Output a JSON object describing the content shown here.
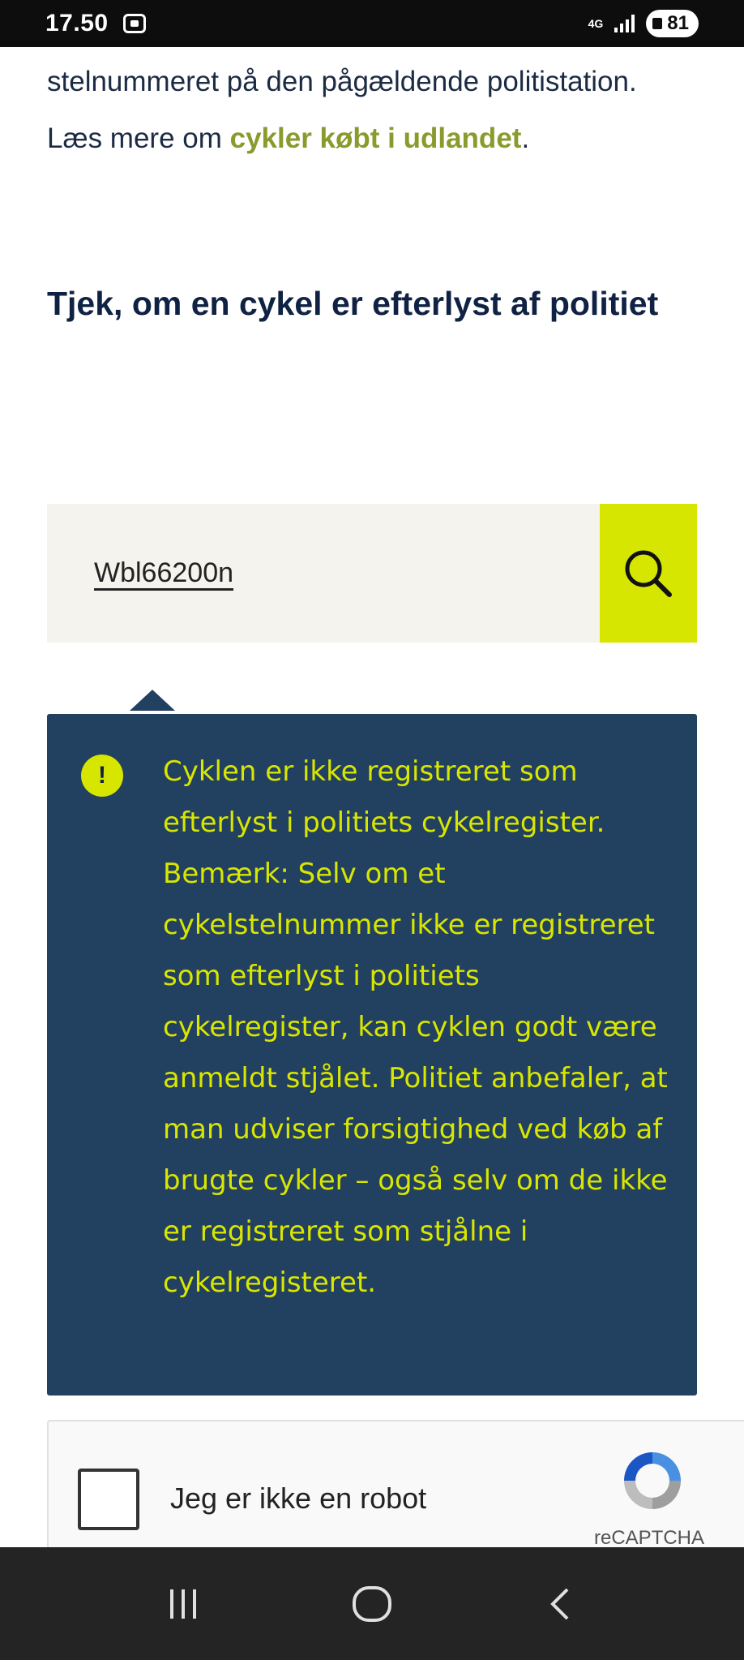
{
  "status_bar": {
    "time": "17.50",
    "network": "4G",
    "battery": "81"
  },
  "intro": {
    "text_before": "stelnummeret på den pågældende politistation. Læs mere om ",
    "link": "cykler købt i udlandet",
    "text_after": "."
  },
  "heading": "Tjek, om en cykel er efterlyst af politiet",
  "search": {
    "value": "Wbl66200n",
    "button_icon": "search-icon"
  },
  "notice": {
    "icon": "exclamation-icon",
    "icon_glyph": "!",
    "message": "Cyklen er ikke registreret som efterlyst i politiets cykelregister. Bemærk: Selv om et cykelstelnummer ikke er registreret som efterlyst i politiets cykelregister, kan cyklen godt være anmeldt stjålet. Politiet anbefaler, at man udviser forsigtighed ved køb af brugte cykler – også selv om de ikke er registreret som stjålne i cykelregisteret."
  },
  "recaptcha": {
    "label": "Jeg er ikke en robot",
    "brand": "reCAPTCHA"
  },
  "colors": {
    "accent_lime": "#d6e600",
    "notice_bg": "#22405f",
    "link_olive": "#8a9a2c",
    "heading_navy": "#0f2244"
  },
  "nav": [
    "recent-apps-icon",
    "home-icon",
    "back-icon"
  ]
}
